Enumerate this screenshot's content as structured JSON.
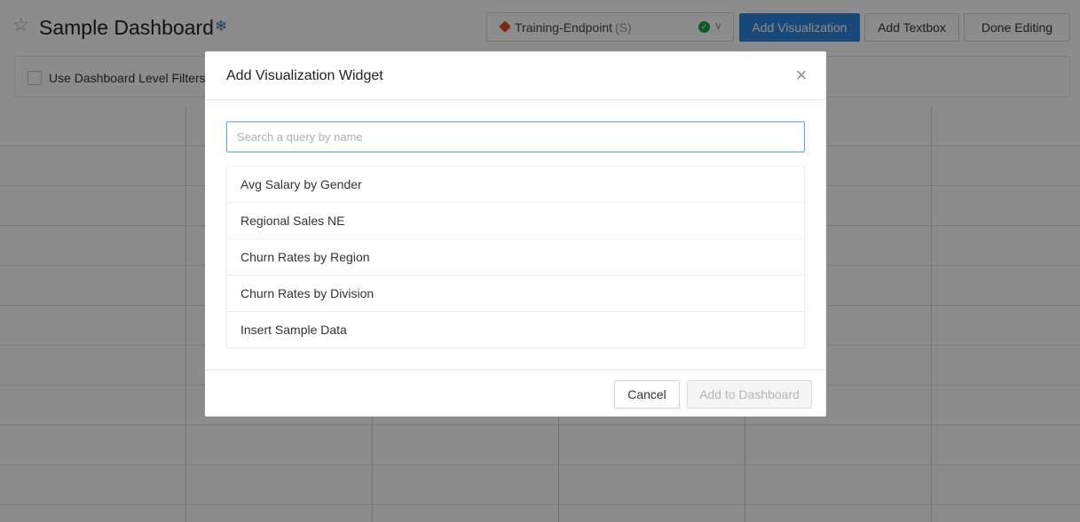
{
  "dashboard": {
    "title": "Sample Dashboard",
    "star_icon": "star-icon",
    "title_icon": "snowflake-icon",
    "endpoint": {
      "name": "Training-Endpoint",
      "size": "(S)",
      "status_icon": "check-circle-icon",
      "status_color": "#1aa34a"
    },
    "buttons": {
      "add_visualization": "Add Visualization",
      "add_textbox": "Add Textbox",
      "done_editing": "Done Editing"
    },
    "filters_label": "Use Dashboard Level Filters",
    "accent_color": "#2a83d9"
  },
  "modal": {
    "title": "Add Visualization Widget",
    "close_icon": "close-icon",
    "search": {
      "placeholder": "Search a query by name",
      "value": ""
    },
    "queries": [
      "Avg Salary by Gender",
      "Regional Sales NE",
      "Churn Rates by Region",
      "Churn Rates by Division",
      "Insert Sample Data"
    ],
    "cancel_label": "Cancel",
    "add_label": "Add to Dashboard"
  }
}
